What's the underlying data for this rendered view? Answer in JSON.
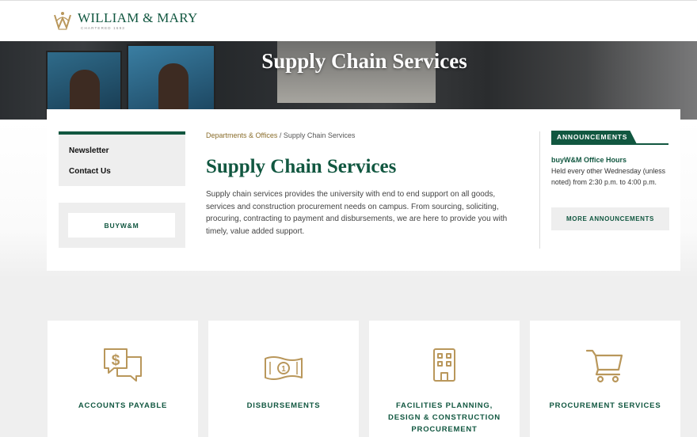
{
  "header": {
    "logo_name": "WILLIAM & MARY",
    "logo_sub": "CHARTERED 1693"
  },
  "hero": {
    "title": "Supply Chain Services"
  },
  "leftnav": {
    "items": [
      {
        "label": "Newsletter"
      },
      {
        "label": "Contact Us"
      }
    ],
    "buy_button": "BUYW&M"
  },
  "breadcrumb": {
    "parent": "Departments & Offices",
    "separator": " / ",
    "current": "Supply Chain Services"
  },
  "main": {
    "title": "Supply Chain Services",
    "intro": "Supply chain services provides the university with end to end support on all goods, services and construction procurement needs on campus. From sourcing, soliciting, procuring, contracting to payment and disbursements, we are here to provide you with timely, value added support."
  },
  "announcements": {
    "heading": "ANNOUNCEMENTS",
    "item_title": "buyW&M Office Hours",
    "item_body": "Held every other Wednesday (unless noted) from 2:30 p.m. to 4:00 p.m.",
    "more_button": "MORE ANNOUNCEMENTS"
  },
  "services": [
    {
      "label": "ACCOUNTS PAYABLE",
      "icon": "chat-dollar-icon"
    },
    {
      "label": "DISBURSEMENTS",
      "icon": "banknote-icon"
    },
    {
      "label": "FACILITIES PLANNING, DESIGN & CONSTRUCTION PROCUREMENT",
      "icon": "building-icon"
    },
    {
      "label": "PROCUREMENT SERVICES",
      "icon": "shopping-cart-icon"
    }
  ],
  "colors": {
    "brand_green": "#115740",
    "brand_gold": "#B9975B",
    "link_gold": "#8a6d2b"
  }
}
